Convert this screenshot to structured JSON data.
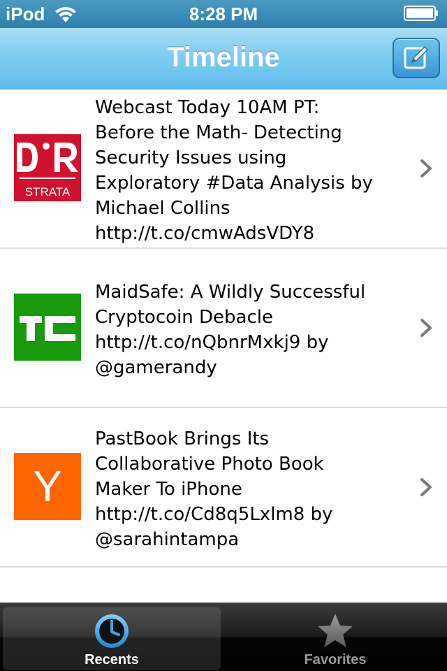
{
  "status_bar": {
    "carrier": "iPod",
    "time": "8:28 PM"
  },
  "nav_bar": {
    "title": "Timeline"
  },
  "rows": [
    {
      "thumb_text": "STRATA",
      "thumb_color": "#d0122f",
      "text": "Webcast Today 10AM PT:\nBefore the Math- Detecting\nSecurity Issues using\nExploratory #Data Analysis by\nMichael Collins\nhttp://t.co/cmwAdsVDY8"
    },
    {
      "thumb_color": "#179a0c",
      "text": "MaidSafe: A Wildly Successful\nCryptocoin Debacle\nhttp://t.co/nQbnrMxkj9 by\n@gamerandy"
    },
    {
      "thumb_text": "Y",
      "thumb_color": "#ff6600",
      "text": "PastBook Brings Its\nCollaborative Photo Book\nMaker To iPhone\nhttp://t.co/Cd8q5Lxlm8 by\n@sarahintampa"
    }
  ],
  "tab_bar": {
    "recents_label": "Recents",
    "favorites_label": "Favorites"
  },
  "colors": {
    "nav_accent": "#5fbcea",
    "recents_icon": "#2f9ae0"
  }
}
